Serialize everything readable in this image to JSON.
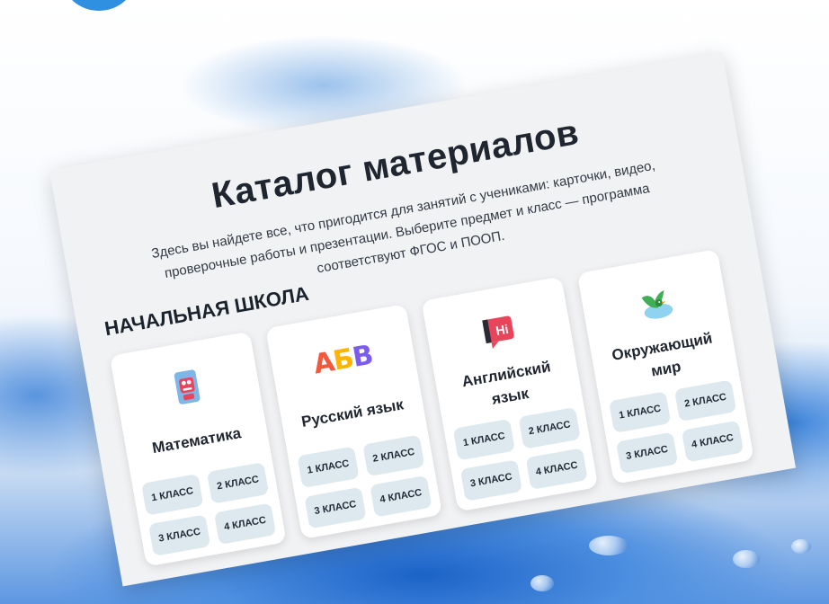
{
  "catalog": {
    "title": "Каталог материалов",
    "description": "Здесь вы найдете все, что пригодится для занятий с учениками: карточки, видео, проверочные работы и презентации. Выберите предмет и класс — программа соответствуют ФГОС и ПООП.",
    "section_title": "НАЧАЛЬНАЯ ШКОЛА",
    "subjects": [
      {
        "name": "Математика",
        "icon": "math-robot-icon",
        "grades": [
          "1 КЛАСС",
          "2 КЛАСС",
          "3 КЛАСС",
          "4 КЛАСС"
        ]
      },
      {
        "name": "Русский язык",
        "icon": "abv-letters-icon",
        "icon_text": {
          "a": "А",
          "b": "Б",
          "v": "В"
        },
        "grades": [
          "1 КЛАСС",
          "2 КЛАСС",
          "3 КЛАСС",
          "4 КЛАСС"
        ]
      },
      {
        "name": "Английский язык",
        "icon": "hi-speech-icon",
        "icon_text": "Hi",
        "grades": [
          "1 КЛАСС",
          "2 КЛАСС",
          "3 КЛАСС",
          "4 КЛАСС"
        ]
      },
      {
        "name": "Окружающий мир",
        "icon": "bird-icon",
        "grades": [
          "1 КЛАСС",
          "2 КЛАСС",
          "3 КЛАСС",
          "4 КЛАСС"
        ]
      }
    ]
  },
  "colors": {
    "card_bg": "#f1f2f4",
    "grade_button_bg": "#dde9ee",
    "accent_blue": "#2f8fe0"
  }
}
